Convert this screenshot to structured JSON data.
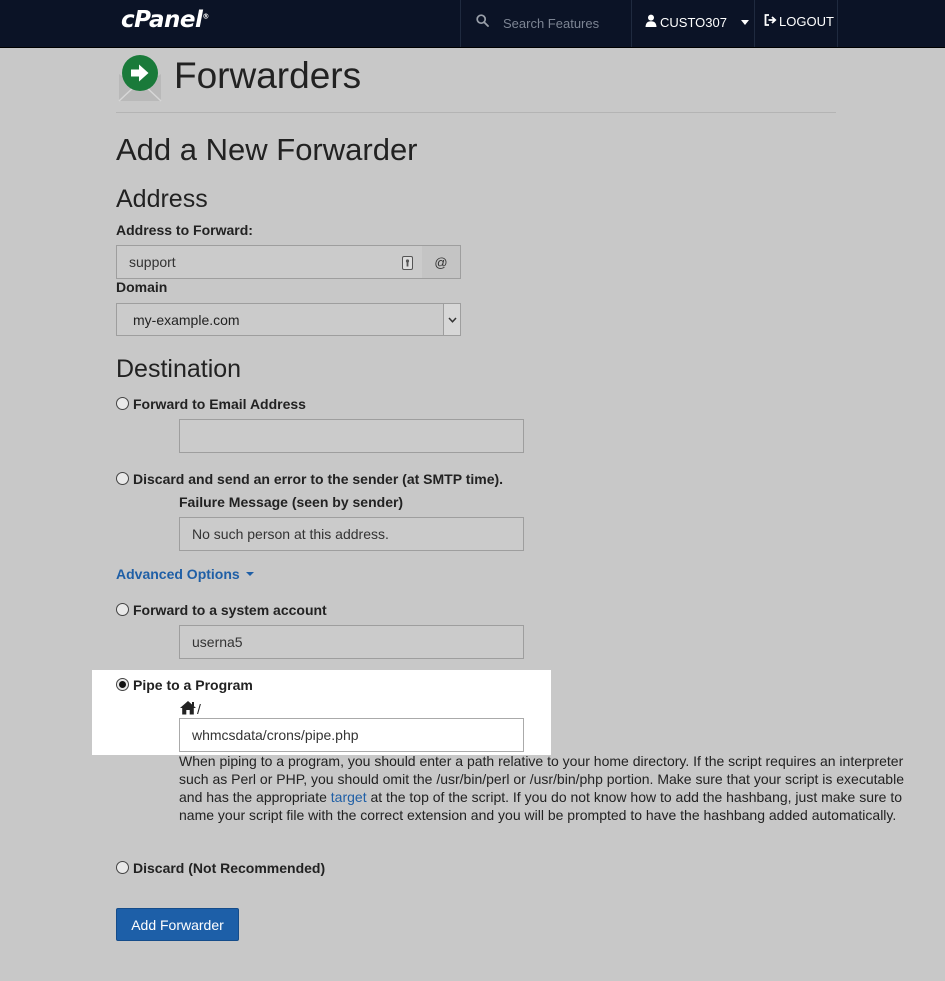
{
  "header": {
    "logo": "cPanel",
    "search_placeholder": "Search Features",
    "username": "CUSTO307",
    "logout_label": "LOGOUT"
  },
  "page": {
    "title": "Forwarders",
    "heading": "Add a New Forwarder"
  },
  "address": {
    "section_title": "Address",
    "forward_label": "Address to Forward:",
    "forward_value": "support",
    "at_symbol": "@",
    "domain_label": "Domain",
    "domain_value": "my-example.com"
  },
  "destination": {
    "section_title": "Destination",
    "forward_email_label": "Forward to Email Address",
    "forward_email_value": "",
    "discard_error_label": "Discard and send an error to the sender (at SMTP time).",
    "failure_message_label": "Failure Message (seen by sender)",
    "failure_message_value": "No such person at this address.",
    "advanced_options_label": "Advanced Options",
    "system_account_label": "Forward to a system account",
    "system_account_value": "userna5",
    "pipe_label": "Pipe to a Program",
    "pipe_home_prefix": "/",
    "pipe_value": "whmcsdata/crons/pipe.php",
    "pipe_help_before": "When piping to a program, you should enter a path relative to your home directory. If the script requires an interpreter such as Perl or PHP, you should omit the /usr/bin/perl or /usr/bin/php portion. Make sure that your script is executable and has the appropriate ",
    "pipe_help_link": "target",
    "pipe_help_after": " at the top of the script. If you do not know how to add the hashbang, just make sure to name your script file with the correct extension and you will be prompted to have the hashbang added automatically.",
    "discard_label": "Discard (Not Recommended)",
    "selected_option": "Pipe to a Program"
  },
  "submit_label": "Add Forwarder",
  "colors": {
    "topbar": "#0b1326",
    "page_background": "#c8c8c8",
    "link": "#1f5fa6",
    "primary_button": "#1d5fa8"
  }
}
